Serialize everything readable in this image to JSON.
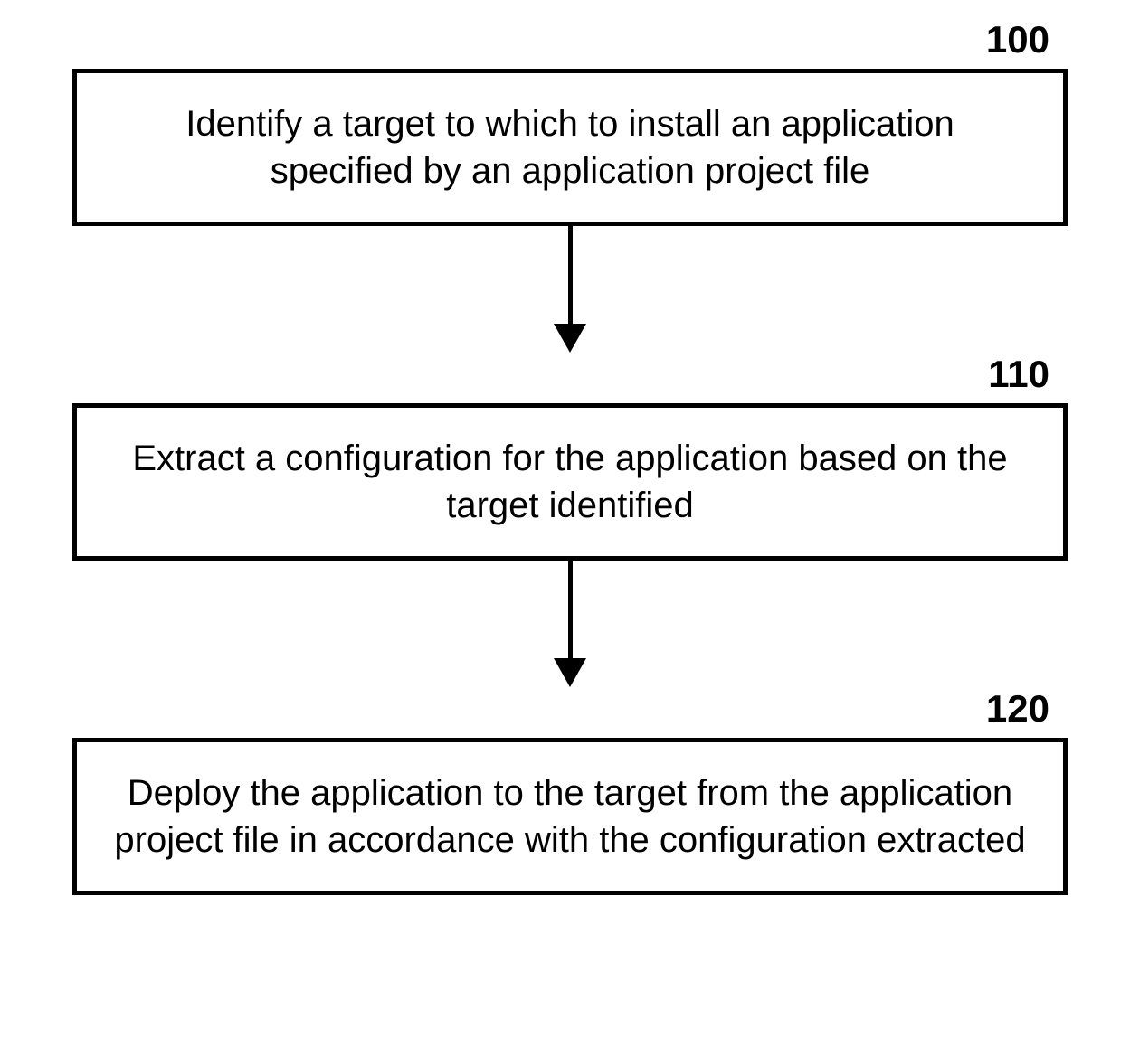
{
  "flowchart": {
    "steps": [
      {
        "label": "100",
        "text": "Identify a target to which to install an application specified by an application project file"
      },
      {
        "label": "110",
        "text": "Extract a configuration for the application based on the target identified"
      },
      {
        "label": "120",
        "text": "Deploy the application to the target from the application project file in accordance with the configuration extracted"
      }
    ]
  }
}
